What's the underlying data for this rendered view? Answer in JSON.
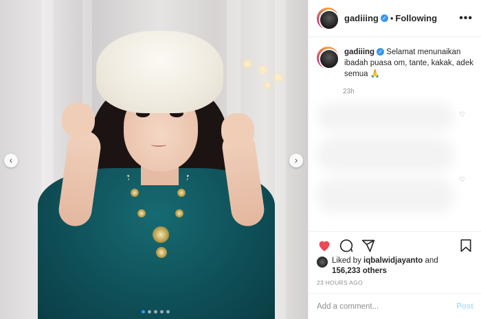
{
  "post": {
    "username": "gadiiing",
    "verified_icon": "verified-badge-icon",
    "separator": "•",
    "following_label": "Following",
    "more_label": "•••",
    "caption": "Selamat menunaikan ibadah puasa om, tante, kakak, adek semua 🙏",
    "caption_time": "23h",
    "liked_by_prefix": "Liked by",
    "liked_by_user": "iqbalwidjayanto",
    "liked_by_and": "and",
    "likes_count": "156,233 others",
    "posted_time": "23 HOURS AGO",
    "comment_placeholder": "Add a comment...",
    "post_label": "Post",
    "carousel_prev": "‹",
    "carousel_next": "›",
    "carousel_count": 5,
    "carousel_active_index": 0
  },
  "colors": {
    "like_red": "#ed4956",
    "verified_blue": "#3897f0",
    "post_button_disabled": "#b2dffc"
  }
}
